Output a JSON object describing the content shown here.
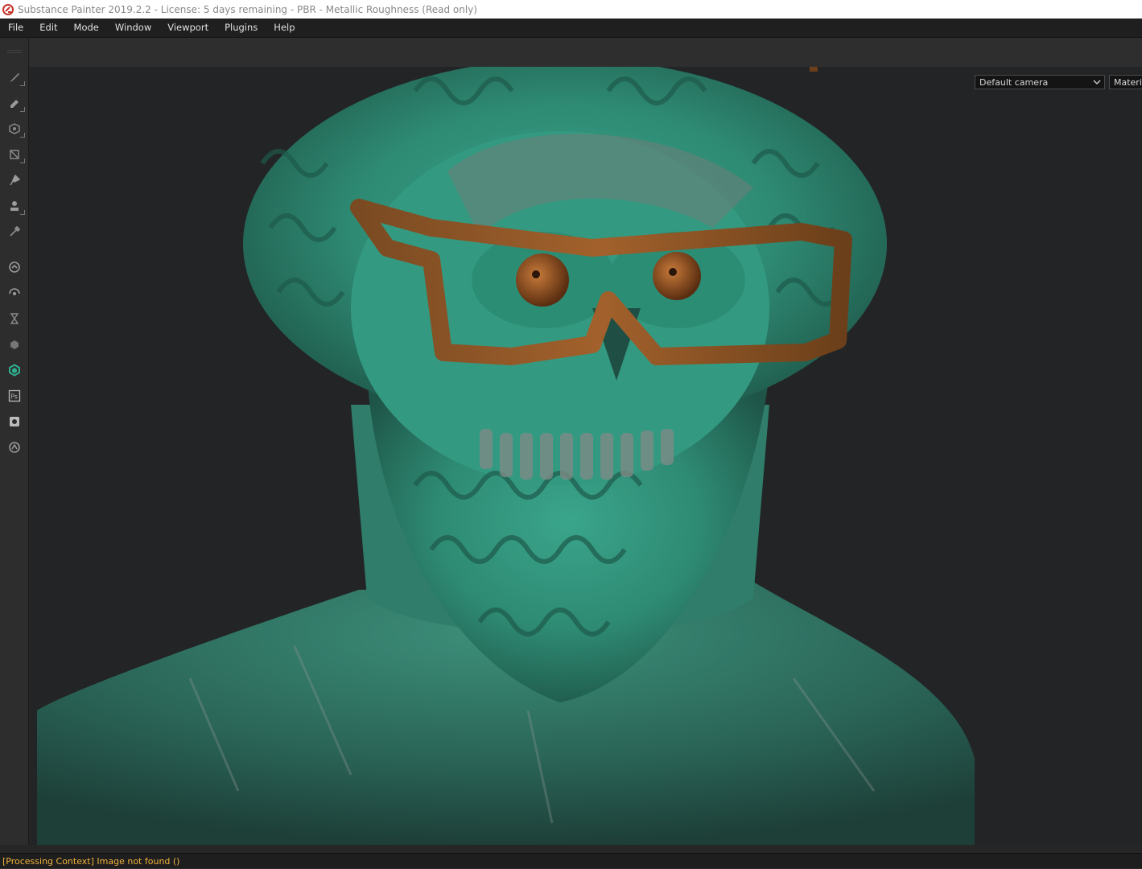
{
  "window": {
    "title": "Substance Painter 2019.2.2 - License: 5 days remaining - PBR - Metallic Roughness (Read only)"
  },
  "menu": [
    "File",
    "Edit",
    "Mode",
    "Window",
    "Viewport",
    "Plugins",
    "Help"
  ],
  "tools": [
    {
      "name": "paint-brush-icon",
      "has_menu": true
    },
    {
      "name": "eraser-icon",
      "has_menu": true
    },
    {
      "name": "projection-icon",
      "has_menu": true
    },
    {
      "name": "geometry-fill-icon",
      "has_menu": true
    },
    {
      "name": "smudge-icon",
      "has_menu": false
    },
    {
      "name": "clone-stamp-icon",
      "has_menu": true
    },
    {
      "name": "color-picker-icon",
      "has_menu": false
    },
    {
      "name": "substance-share-icon",
      "has_menu": false
    },
    {
      "name": "iray-render-icon",
      "has_menu": false
    },
    {
      "name": "bake-timer-icon",
      "has_menu": false
    },
    {
      "name": "substance-source-icon",
      "has_menu": false
    },
    {
      "name": "substance-designer-icon",
      "has_menu": false
    },
    {
      "name": "photoshop-export-icon",
      "has_menu": false
    },
    {
      "name": "screenshot-export-icon",
      "has_menu": false
    },
    {
      "name": "substance-settings-icon",
      "has_menu": false
    }
  ],
  "viewport": {
    "camera_select": "Default camera",
    "material_select": "Materia"
  },
  "status": {
    "message": "[Processing Context] Image not found ()"
  },
  "colors": {
    "accent_teal": "#2fae8f",
    "status_orange": "#f0b23c",
    "wood_frame": "#8a4f22"
  }
}
